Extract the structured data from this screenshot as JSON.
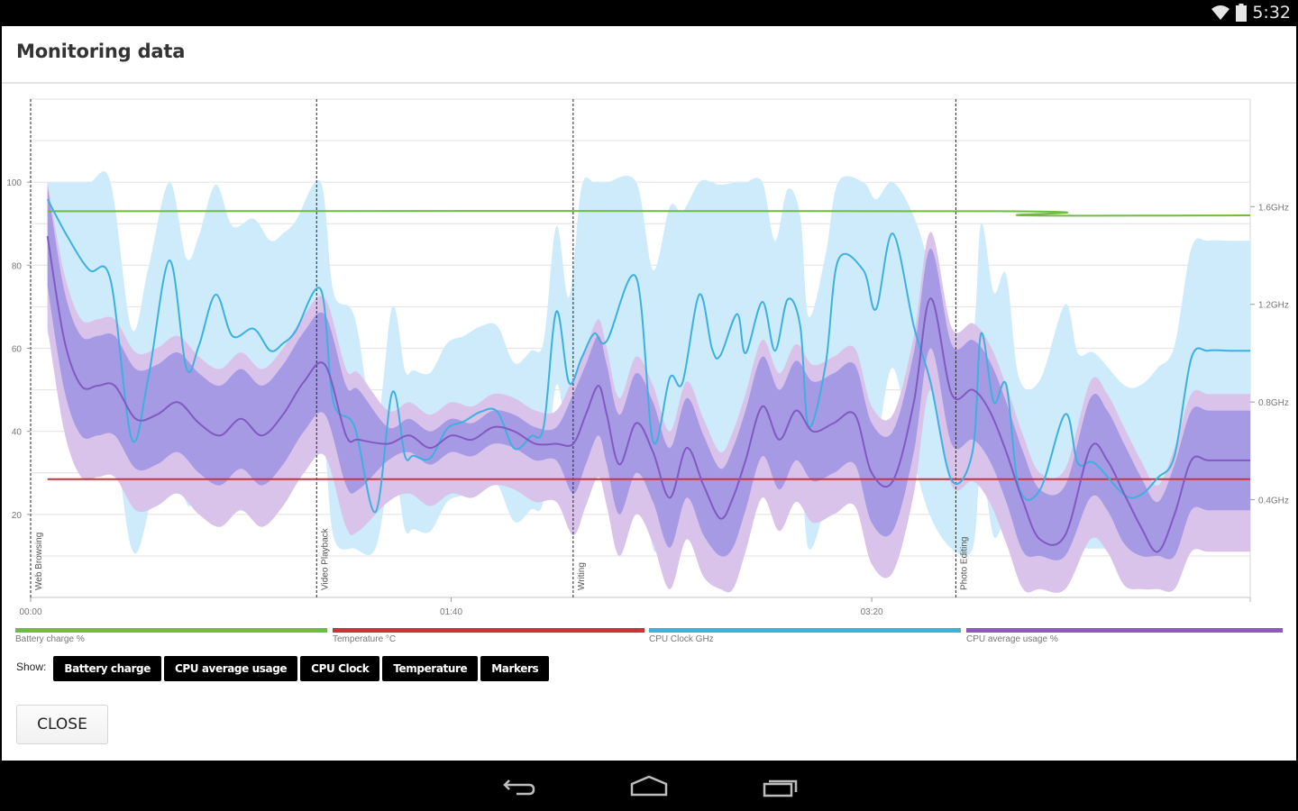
{
  "status_bar": {
    "time": "5:32",
    "icons": [
      "wifi-icon",
      "battery-icon"
    ]
  },
  "dialog": {
    "title": "Monitoring data",
    "close_label": "CLOSE",
    "show_label": "Show:",
    "toggles": [
      {
        "label": "Battery charge"
      },
      {
        "label": "CPU average usage"
      },
      {
        "label": "CPU Clock"
      },
      {
        "label": "Temperature"
      },
      {
        "label": "Markers"
      }
    ]
  },
  "nav_bar": {
    "buttons": [
      "back-icon",
      "home-icon",
      "recents-icon"
    ]
  },
  "colors": {
    "battery": "#6dbd3f",
    "temperature": "#c9343a",
    "cpu_clock": "#3cb1e0",
    "cpu_clock_band": "#cdebfa",
    "cpu_usage": "#8059c2",
    "cpu_usage_band": "#b7a6e6",
    "cpu_usage_band_light": "#d9c3ea"
  },
  "chart_data": {
    "type": "line",
    "title": "",
    "xlabel": "",
    "ylabel": "",
    "xlim_seconds": [
      0,
      290
    ],
    "ylim": [
      0,
      120
    ],
    "y_ticks": [
      20,
      40,
      60,
      80,
      100
    ],
    "y_tick_labels": [
      "20",
      "40",
      "60",
      "80",
      "100"
    ],
    "y2_ticks_ghz": [
      0.4,
      0.8,
      1.2,
      1.6
    ],
    "y2_tick_labels": [
      "0.4GHz",
      "0.8GHz",
      "1.2GHz",
      "1.6GHz"
    ],
    "y2lim_ghz": [
      0,
      2.04
    ],
    "x_ticks_seconds": [
      0,
      100,
      200
    ],
    "x_tick_labels": [
      "00:00",
      "01:40",
      "03:20"
    ],
    "grid": true,
    "markers": [
      {
        "label": "Web Browsing",
        "t": 0
      },
      {
        "label": "Video Playback",
        "t": 68
      },
      {
        "label": "Writing",
        "t": 129
      },
      {
        "label": "Photo Editing",
        "t": 220
      }
    ],
    "legend": [
      {
        "name": "Battery charge %",
        "color_key": "battery"
      },
      {
        "name": "Temperature °C",
        "color_key": "temperature"
      },
      {
        "name": "CPU Clock GHz",
        "color_key": "cpu_clock"
      },
      {
        "name": "CPU average usage %",
        "color_key": "cpu_usage"
      }
    ],
    "legend_position": "bottom",
    "series": [
      {
        "name": "Battery charge %",
        "axis": "left",
        "t": [
          4,
          230,
          236,
          290
        ],
        "values": [
          93,
          93,
          92,
          92
        ]
      },
      {
        "name": "Temperature °C",
        "axis": "left",
        "t": [
          4,
          290
        ],
        "values": [
          28.5,
          28.5
        ]
      },
      {
        "name": "CPU Clock GHz",
        "axis": "right",
        "t": [
          4,
          9,
          14,
          19,
          24,
          28,
          33,
          37,
          40,
          44,
          48,
          53,
          57,
          60,
          63,
          69,
          72,
          77,
          82,
          86,
          89,
          91,
          95,
          99,
          103,
          107,
          111,
          115,
          119,
          122,
          125,
          128,
          131,
          134,
          137,
          144,
          148,
          152,
          155,
          159,
          162,
          164,
          168,
          170,
          174,
          177,
          180,
          183,
          185,
          189,
          192,
          198,
          201,
          205,
          210,
          214,
          219,
          224,
          226,
          229,
          232,
          235,
          240,
          246,
          249,
          253,
          260,
          264,
          268,
          272,
          276,
          280,
          285,
          290
        ],
        "values": [
          1.63,
          1.47,
          1.34,
          1.3,
          0.65,
          0.9,
          1.38,
          0.94,
          1.03,
          1.24,
          1.07,
          1.1,
          1.01,
          1.04,
          1.09,
          1.26,
          0.8,
          0.7,
          0.35,
          0.84,
          0.58,
          0.58,
          0.57,
          0.69,
          0.72,
          0.76,
          0.76,
          0.61,
          0.66,
          0.7,
          1.17,
          0.88,
          0.98,
          1.08,
          1.05,
          1.31,
          0.64,
          0.9,
          0.88,
          1.24,
          1.02,
          0.99,
          1.16,
          1.0,
          1.21,
          1.01,
          1.22,
          1.11,
          0.7,
          0.95,
          1.38,
          1.34,
          1.18,
          1.49,
          1.11,
          0.88,
          0.48,
          0.6,
          1.08,
          0.8,
          0.87,
          0.45,
          0.44,
          0.75,
          0.55,
          0.55,
          0.42,
          0.42,
          0.49,
          0.58,
          0.98,
          1.01,
          1.01,
          1.01
        ]
      },
      {
        "name": "CPU average usage %",
        "axis": "left",
        "t": [
          4,
          8,
          12,
          16,
          20,
          25,
          30,
          35,
          40,
          45,
          50,
          55,
          60,
          65,
          70,
          75,
          78,
          85,
          90,
          95,
          100,
          105,
          110,
          115,
          120,
          125,
          129,
          132,
          135,
          137,
          140,
          144,
          148,
          152,
          156,
          160,
          164,
          167,
          170,
          174,
          178,
          182,
          186,
          191,
          196,
          200,
          205,
          210,
          214,
          219,
          224,
          228,
          232,
          236,
          240,
          246,
          252,
          256,
          260,
          264,
          268,
          272,
          276,
          280,
          286,
          290
        ],
        "values": [
          87,
          62,
          51,
          51,
          51,
          43,
          44,
          47,
          42,
          39,
          43,
          39,
          44,
          52,
          56,
          39,
          38,
          37,
          39,
          36,
          39,
          38,
          41,
          40,
          37,
          37,
          37,
          44,
          51,
          44,
          32,
          42,
          35,
          24,
          36,
          27,
          19,
          24,
          33,
          46,
          38,
          45,
          40,
          42,
          44,
          30,
          28,
          47,
          72,
          49,
          50,
          45,
          35,
          23,
          14,
          15,
          36,
          33,
          25,
          17,
          11,
          20,
          33,
          33,
          33,
          33
        ]
      }
    ]
  }
}
